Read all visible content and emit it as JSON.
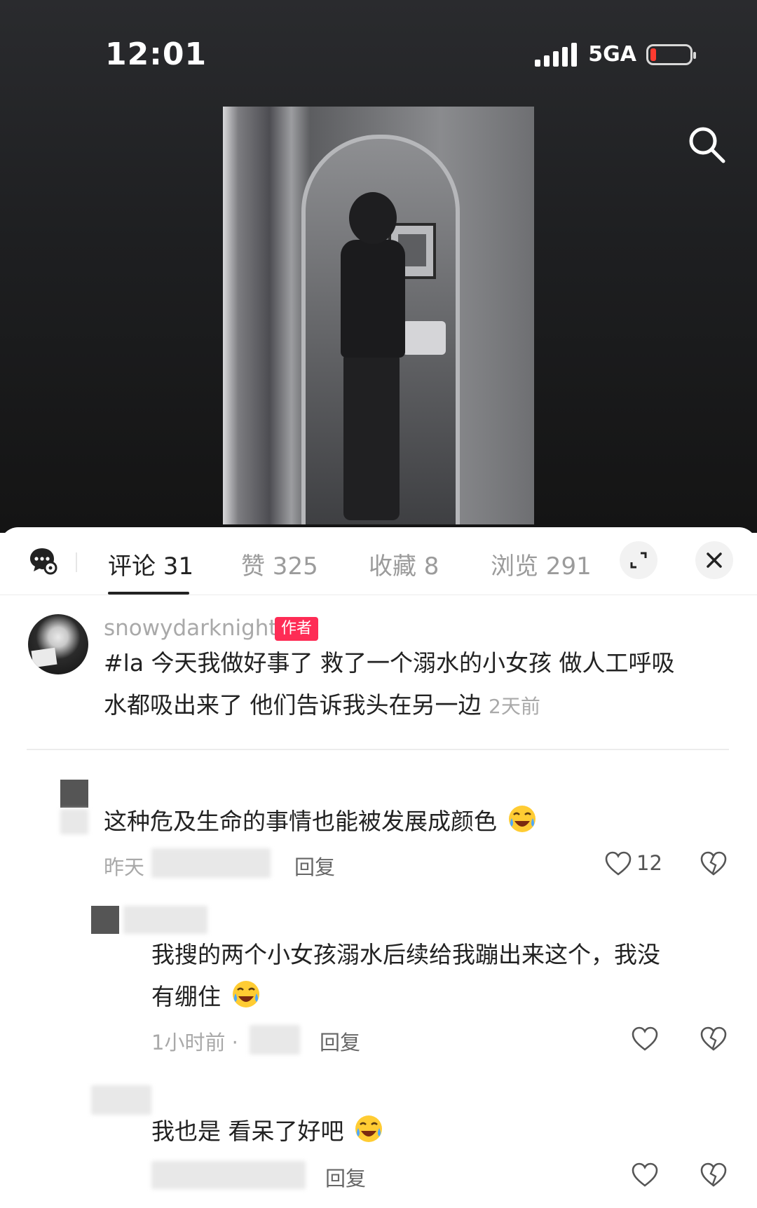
{
  "status_bar": {
    "time": "12:01",
    "network": "5GA",
    "battery_level": 0.1
  },
  "icons": {
    "search": "search-icon",
    "chat": "chat-settings-icon",
    "expand": "expand-icon",
    "close": "close-icon",
    "heart": "heart-icon",
    "dislike": "broken-heart-icon",
    "emoji": "crying-laughing-emoji"
  },
  "tabs": [
    {
      "label": "评论 31"
    },
    {
      "label": "赞 325"
    },
    {
      "label": "收藏 8"
    },
    {
      "label": "浏览 291"
    }
  ],
  "author_comment": {
    "username": "snowydarknight",
    "badge": "作者",
    "line1": "#la 今天我做好事了 救了一个溺水的小女孩 做人工呼吸",
    "line2": "水都吸出来了 他们告诉我头在另一边",
    "time": "2天前"
  },
  "comments": [
    {
      "text": "这种危及生命的事情也能被发展成颜色",
      "time": "昨天",
      "reply": "回复",
      "likes": "12"
    },
    {
      "line1": "我搜的两个小女孩溺水后续给我蹦出来这个，我没",
      "line2": "有绷住",
      "time": "1小时前 ·",
      "reply": "回复"
    },
    {
      "text": "我也是 看呆了好吧",
      "reply": "回复"
    }
  ],
  "colors": {
    "accent": "#fe2c55",
    "text": "#222222",
    "muted": "#a9a9a9"
  }
}
